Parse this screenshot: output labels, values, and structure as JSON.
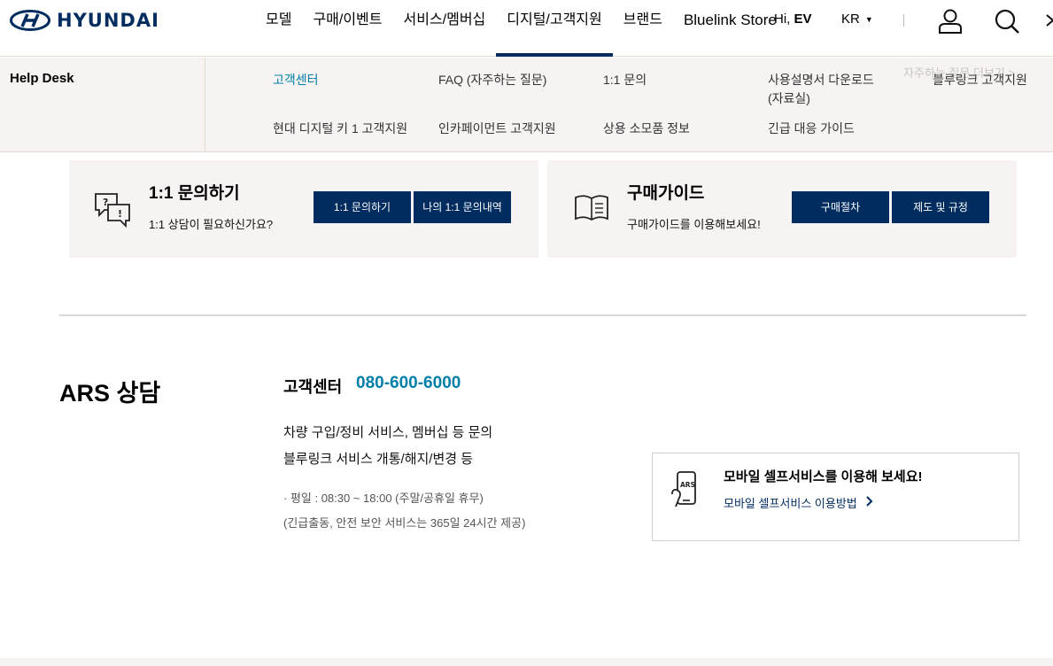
{
  "header": {
    "logo_text": "HYUNDAI",
    "nav": [
      "모델",
      "구매/이벤트",
      "서비스/멤버십",
      "디지털/고객지원",
      "브랜드",
      "Bluelink Store"
    ],
    "hi_prefix": "Hi,",
    "hi_name": "EV",
    "lang": "KR",
    "icons": [
      "user-icon",
      "search-icon"
    ]
  },
  "submenu": {
    "title": "Help Desk",
    "faq_more": "자주하는 질문 더보기",
    "links": [
      "고객센터",
      "FAQ (자주하는 질문)",
      "1:1 문의",
      "사용설명서 다운로드",
      "(자료실)",
      "블루링크 고객지원",
      "현대 디지털 키 1 고객지원",
      "인카페이먼트 고객지원",
      "상용 소모품 정보",
      "긴급 대응 가이드"
    ]
  },
  "cards": [
    {
      "icon": "chat-question-icon",
      "title": "1:1 문의하기",
      "desc": "1:1 상담이 필요하신가요?",
      "buttons": [
        "1:1 문의하기",
        "나의 1:1 문의내역"
      ]
    },
    {
      "icon": "open-book-icon",
      "title": "구매가이드",
      "desc": "구매가이드를 이용해보세요!",
      "buttons": [
        "구매절차",
        "제도 및 규정"
      ]
    }
  ],
  "ars": {
    "title": "ARS 상담",
    "center_label": "고객센터",
    "phone": "080-600-6000",
    "lines": [
      "차량 구입/정비 서비스, 멤버십 등 문의",
      "블루링크 서비스 개통/해지/변경 등"
    ],
    "hours": "· 평일 : 08:30 ~ 18:00 (주말/공휴일 휴무)",
    "note": "(긴급출동, 안전 보안 서비스는 365일 24시간 제공)"
  },
  "mobile": {
    "icon": "mobile-ars-icon",
    "badge": "ARS",
    "title": "모바일 셀프서비스를 이용해 보세요!",
    "link": "모바일 셀프서비스 이용방법"
  },
  "colors": {
    "navy": "#002c5f",
    "teal": "#007fa8",
    "panel": "#f6f3f2"
  }
}
